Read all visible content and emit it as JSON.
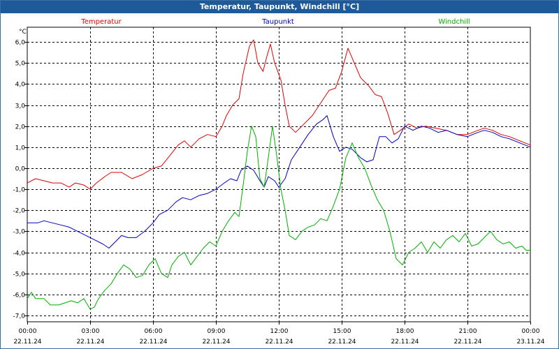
{
  "window": {
    "title": "Temperatur, Taupunkt, Windchill [°C]"
  },
  "chart_data": {
    "type": "line",
    "title": "Temperatur, Taupunkt, Windchill [°C]",
    "ylabel": "°C",
    "xlabel": "",
    "ylim": [
      -7.3,
      6.7
    ],
    "xlim": [
      0,
      24
    ],
    "grid": true,
    "legend": "top",
    "y_ticks": [
      "6,0",
      "5,0",
      "4,0",
      "3,0",
      "2,0",
      "1,0",
      "0,0",
      "-1,0",
      "-2,0",
      "-3,0",
      "-4,0",
      "-5,0",
      "-6,0",
      "-7,0"
    ],
    "x_ticks": [
      {
        "time": "00:00",
        "date": "22.11.24"
      },
      {
        "time": "03:00",
        "date": "22.11.24"
      },
      {
        "time": "06:00",
        "date": "22.11.24"
      },
      {
        "time": "09:00",
        "date": "22.11.24"
      },
      {
        "time": "12:00",
        "date": "22.11.24"
      },
      {
        "time": "15:00",
        "date": "22.11.24"
      },
      {
        "time": "18:00",
        "date": "22.11.24"
      },
      {
        "time": "21:00",
        "date": "22.11.24"
      },
      {
        "time": "00:00",
        "date": "23.11.24"
      }
    ],
    "series": [
      {
        "name": "Temperatur",
        "color": "#e00000",
        "points": [
          [
            0,
            -0.7
          ],
          [
            0.4,
            -0.5
          ],
          [
            0.8,
            -0.6
          ],
          [
            1.2,
            -0.7
          ],
          [
            1.6,
            -0.7
          ],
          [
            2.0,
            -0.9
          ],
          [
            2.3,
            -0.7
          ],
          [
            2.7,
            -0.8
          ],
          [
            3.0,
            -1.0
          ],
          [
            3.3,
            -0.7
          ],
          [
            3.7,
            -0.4
          ],
          [
            4.0,
            -0.2
          ],
          [
            4.5,
            -0.2
          ],
          [
            5.0,
            -0.5
          ],
          [
            5.5,
            -0.3
          ],
          [
            6.0,
            0.0
          ],
          [
            6.4,
            0.1
          ],
          [
            6.8,
            0.6
          ],
          [
            7.2,
            1.1
          ],
          [
            7.5,
            1.3
          ],
          [
            7.8,
            1.0
          ],
          [
            8.2,
            1.4
          ],
          [
            8.6,
            1.6
          ],
          [
            9.0,
            1.5
          ],
          [
            9.3,
            2.0
          ],
          [
            9.5,
            2.5
          ],
          [
            9.8,
            3.0
          ],
          [
            10.1,
            3.3
          ],
          [
            10.3,
            4.5
          ],
          [
            10.6,
            5.8
          ],
          [
            10.8,
            6.1
          ],
          [
            11.0,
            5.0
          ],
          [
            11.25,
            4.6
          ],
          [
            11.4,
            5.2
          ],
          [
            11.6,
            5.9
          ],
          [
            11.8,
            5.0
          ],
          [
            12.1,
            4.2
          ],
          [
            12.3,
            3.0
          ],
          [
            12.5,
            2.0
          ],
          [
            12.8,
            1.7
          ],
          [
            13.2,
            2.1
          ],
          [
            13.6,
            2.5
          ],
          [
            14.0,
            3.1
          ],
          [
            14.4,
            3.7
          ],
          [
            14.7,
            3.8
          ],
          [
            15.0,
            4.6
          ],
          [
            15.3,
            5.7
          ],
          [
            15.6,
            5.0
          ],
          [
            15.9,
            4.3
          ],
          [
            16.3,
            3.9
          ],
          [
            16.6,
            3.5
          ],
          [
            16.9,
            3.4
          ],
          [
            17.2,
            2.6
          ],
          [
            17.5,
            1.6
          ],
          [
            17.8,
            1.8
          ],
          [
            18.2,
            2.1
          ],
          [
            18.6,
            1.9
          ],
          [
            19.0,
            2.0
          ],
          [
            19.5,
            1.9
          ],
          [
            20.0,
            1.8
          ],
          [
            20.5,
            1.6
          ],
          [
            21.0,
            1.6
          ],
          [
            21.5,
            1.8
          ],
          [
            21.8,
            1.9
          ],
          [
            22.2,
            1.8
          ],
          [
            22.6,
            1.6
          ],
          [
            23.0,
            1.5
          ],
          [
            23.5,
            1.3
          ],
          [
            24.0,
            1.1
          ]
        ]
      },
      {
        "name": "Taupunkt",
        "color": "#0000c0",
        "points": [
          [
            0,
            -2.6
          ],
          [
            0.5,
            -2.6
          ],
          [
            0.8,
            -2.5
          ],
          [
            1.2,
            -2.6
          ],
          [
            1.6,
            -2.7
          ],
          [
            2.0,
            -2.8
          ],
          [
            2.4,
            -3.0
          ],
          [
            2.8,
            -3.2
          ],
          [
            3.2,
            -3.4
          ],
          [
            3.6,
            -3.6
          ],
          [
            3.9,
            -3.8
          ],
          [
            4.2,
            -3.5
          ],
          [
            4.5,
            -3.2
          ],
          [
            4.8,
            -3.3
          ],
          [
            5.2,
            -3.3
          ],
          [
            5.6,
            -3.0
          ],
          [
            6.0,
            -2.6
          ],
          [
            6.3,
            -2.2
          ],
          [
            6.7,
            -2.0
          ],
          [
            7.1,
            -1.6
          ],
          [
            7.4,
            -1.4
          ],
          [
            7.8,
            -1.5
          ],
          [
            8.2,
            -1.3
          ],
          [
            8.6,
            -1.2
          ],
          [
            9.0,
            -1.0
          ],
          [
            9.4,
            -0.7
          ],
          [
            9.7,
            -0.5
          ],
          [
            10.0,
            -0.6
          ],
          [
            10.2,
            -0.1
          ],
          [
            10.5,
            0.1
          ],
          [
            10.8,
            -0.1
          ],
          [
            11.1,
            -0.6
          ],
          [
            11.3,
            -0.9
          ],
          [
            11.5,
            -0.4
          ],
          [
            11.8,
            -0.6
          ],
          [
            12.0,
            -0.9
          ],
          [
            12.3,
            -0.5
          ],
          [
            12.6,
            0.4
          ],
          [
            13.0,
            1.0
          ],
          [
            13.4,
            1.6
          ],
          [
            13.8,
            2.1
          ],
          [
            14.1,
            2.3
          ],
          [
            14.3,
            2.5
          ],
          [
            14.6,
            1.5
          ],
          [
            14.9,
            0.8
          ],
          [
            15.2,
            1.0
          ],
          [
            15.5,
            0.9
          ],
          [
            15.9,
            0.5
          ],
          [
            16.2,
            0.3
          ],
          [
            16.5,
            0.4
          ],
          [
            16.8,
            1.5
          ],
          [
            17.1,
            1.5
          ],
          [
            17.4,
            1.2
          ],
          [
            17.7,
            1.4
          ],
          [
            18.0,
            2.0
          ],
          [
            18.4,
            1.8
          ],
          [
            18.8,
            2.0
          ],
          [
            19.2,
            1.9
          ],
          [
            19.6,
            1.7
          ],
          [
            20.0,
            1.8
          ],
          [
            20.5,
            1.6
          ],
          [
            21.0,
            1.5
          ],
          [
            21.5,
            1.7
          ],
          [
            21.8,
            1.8
          ],
          [
            22.2,
            1.7
          ],
          [
            22.6,
            1.5
          ],
          [
            23.0,
            1.4
          ],
          [
            23.5,
            1.2
          ],
          [
            24.0,
            1.0
          ]
        ]
      },
      {
        "name": "Windchill",
        "color": "#00b000",
        "points": [
          [
            0,
            -6.2
          ],
          [
            0.2,
            -5.9
          ],
          [
            0.4,
            -6.2
          ],
          [
            0.8,
            -6.2
          ],
          [
            1.1,
            -6.5
          ],
          [
            1.5,
            -6.5
          ],
          [
            1.8,
            -6.4
          ],
          [
            2.1,
            -6.3
          ],
          [
            2.4,
            -6.4
          ],
          [
            2.7,
            -6.2
          ],
          [
            3.0,
            -6.7
          ],
          [
            3.2,
            -6.6
          ],
          [
            3.4,
            -6.2
          ],
          [
            3.7,
            -5.8
          ],
          [
            4.0,
            -5.5
          ],
          [
            4.3,
            -5.0
          ],
          [
            4.6,
            -4.6
          ],
          [
            4.9,
            -4.8
          ],
          [
            5.2,
            -5.2
          ],
          [
            5.5,
            -5.1
          ],
          [
            5.8,
            -4.6
          ],
          [
            6.1,
            -4.3
          ],
          [
            6.4,
            -5.0
          ],
          [
            6.7,
            -5.2
          ],
          [
            6.9,
            -4.6
          ],
          [
            7.2,
            -4.2
          ],
          [
            7.5,
            -4.0
          ],
          [
            7.8,
            -4.6
          ],
          [
            8.1,
            -4.2
          ],
          [
            8.4,
            -3.8
          ],
          [
            8.7,
            -3.5
          ],
          [
            9.0,
            -3.7
          ],
          [
            9.3,
            -3.0
          ],
          [
            9.6,
            -2.5
          ],
          [
            9.9,
            -2.1
          ],
          [
            10.1,
            -2.3
          ],
          [
            10.3,
            -0.8
          ],
          [
            10.5,
            0.8
          ],
          [
            10.7,
            2.0
          ],
          [
            10.9,
            1.5
          ],
          [
            11.1,
            -0.5
          ],
          [
            11.3,
            -0.9
          ],
          [
            11.5,
            0.5
          ],
          [
            11.7,
            2.0
          ],
          [
            11.9,
            0.6
          ],
          [
            12.1,
            -1.0
          ],
          [
            12.3,
            -2.0
          ],
          [
            12.5,
            -3.2
          ],
          [
            12.8,
            -3.4
          ],
          [
            13.1,
            -3.0
          ],
          [
            13.4,
            -2.8
          ],
          [
            13.7,
            -2.7
          ],
          [
            14.0,
            -2.4
          ],
          [
            14.3,
            -2.5
          ],
          [
            14.6,
            -1.8
          ],
          [
            14.9,
            -1.0
          ],
          [
            15.2,
            0.5
          ],
          [
            15.5,
            1.2
          ],
          [
            15.8,
            0.5
          ],
          [
            16.1,
            0.0
          ],
          [
            16.4,
            -0.8
          ],
          [
            16.7,
            -1.5
          ],
          [
            17.0,
            -2.0
          ],
          [
            17.3,
            -3.0
          ],
          [
            17.6,
            -4.3
          ],
          [
            17.9,
            -4.6
          ],
          [
            18.2,
            -4.0
          ],
          [
            18.5,
            -3.8
          ],
          [
            18.8,
            -3.5
          ],
          [
            19.1,
            -4.0
          ],
          [
            19.4,
            -3.5
          ],
          [
            19.7,
            -3.8
          ],
          [
            20.0,
            -3.4
          ],
          [
            20.3,
            -3.2
          ],
          [
            20.6,
            -3.5
          ],
          [
            20.9,
            -3.1
          ],
          [
            21.2,
            -3.7
          ],
          [
            21.5,
            -3.6
          ],
          [
            21.8,
            -3.3
          ],
          [
            22.1,
            -3.0
          ],
          [
            22.4,
            -3.4
          ],
          [
            22.7,
            -3.6
          ],
          [
            23.0,
            -3.5
          ],
          [
            23.3,
            -3.8
          ],
          [
            23.6,
            -3.7
          ],
          [
            23.8,
            -3.9
          ],
          [
            24.0,
            -3.9
          ]
        ]
      }
    ]
  }
}
